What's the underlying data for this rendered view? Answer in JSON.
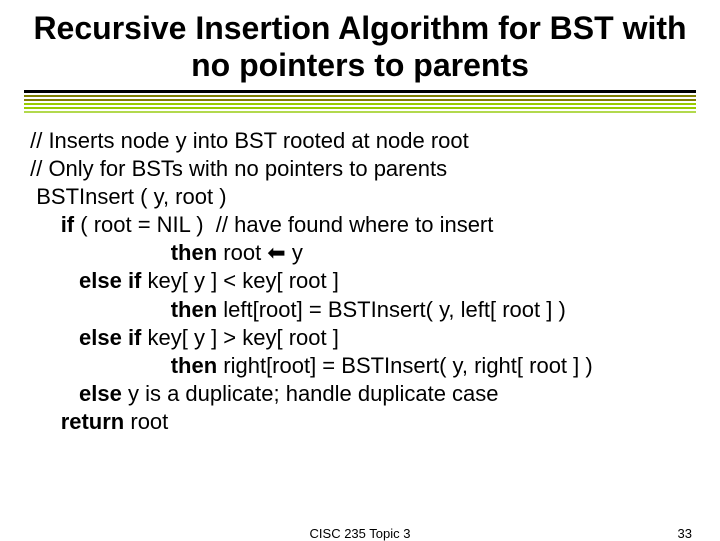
{
  "title": "Recursive Insertion Algorithm for BST with no pointers to parents",
  "rules": [
    "#000000",
    "#7f7f00",
    "#808000",
    "#99cc00",
    "#99cc00",
    "#b2d94d"
  ],
  "code": {
    "l1": " // Inserts node y into BST rooted at node root",
    "l2": " // Only for BSTs with no pointers to parents",
    "l3": "  BSTInsert ( y, root )",
    "l4a": "      ",
    "l4b": "if",
    "l4c": " ( root = NIL )  // have found where to insert",
    "l5a": "                        ",
    "l5b": "then",
    "l5c": " root ",
    "l5d": "⬅",
    "l5e": " y",
    "l6a": "         ",
    "l6b": "else if",
    "l6c": " key[ y ] < key[ root ]",
    "l7a": "                        ",
    "l7b": "then",
    "l7c": " left[root] = BSTInsert( y, left[ root ] )",
    "l8a": "         ",
    "l8b": "else if",
    "l8c": " key[ y ] > key[ root ]",
    "l9a": "                        ",
    "l9b": "then",
    "l9c": " right[root] = BSTInsert( y, right[ root ] )",
    "l10a": "         ",
    "l10b": "else",
    "l10c": " y is a duplicate; handle duplicate case",
    "l11a": "      ",
    "l11b": "return",
    "l11c": " root"
  },
  "footer": {
    "center": "CISC 235 Topic 3",
    "right": "33"
  }
}
